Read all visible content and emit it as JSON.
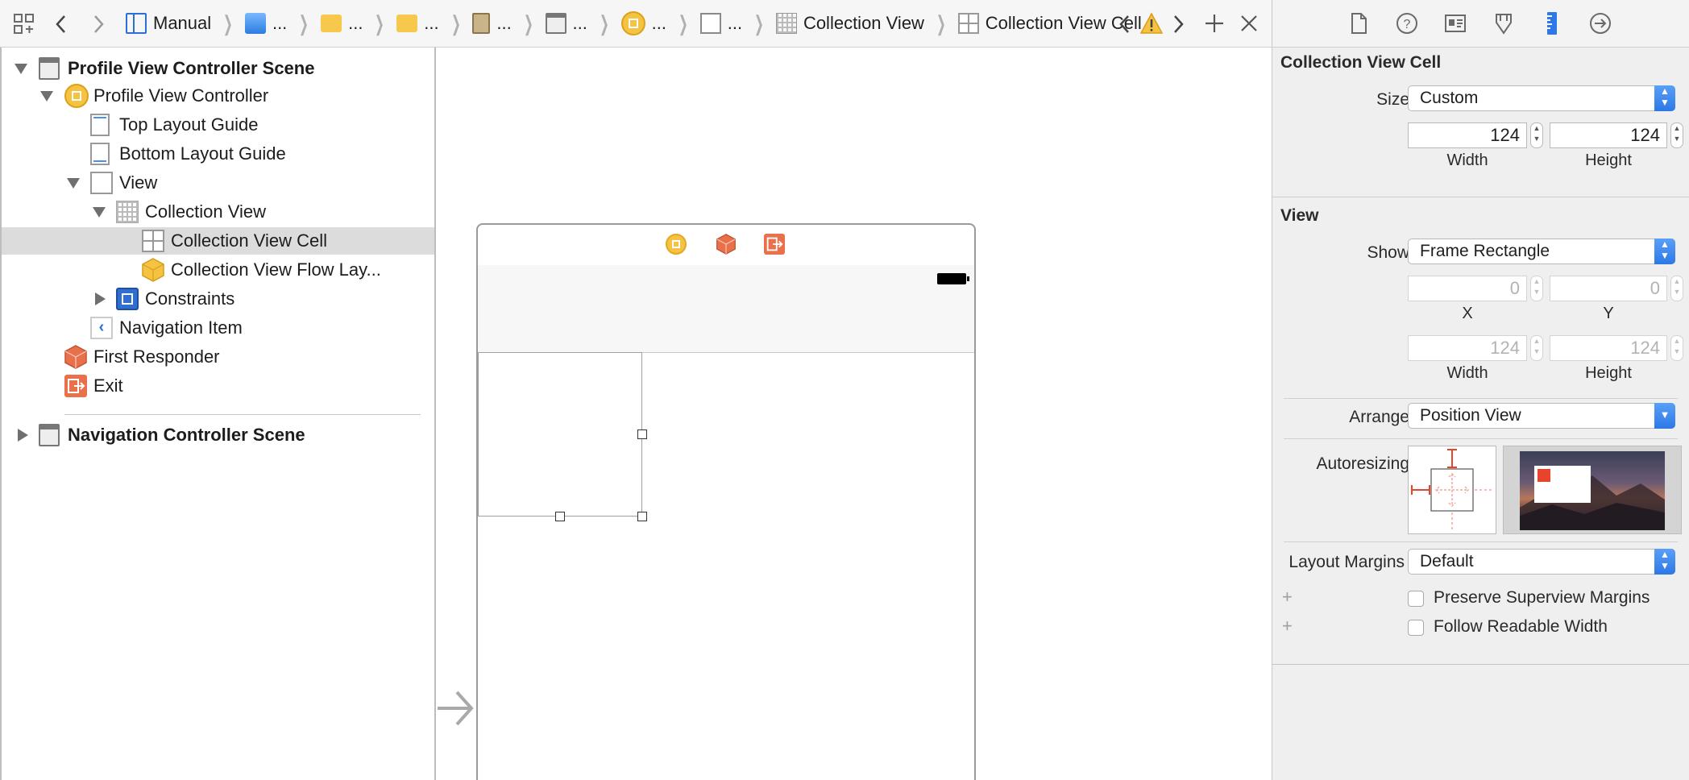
{
  "jumpbar": {
    "crumbs": [
      {
        "label": "Manual",
        "icon": "split-view-icon"
      },
      {
        "label": "...",
        "icon": "xcode-app-icon"
      },
      {
        "label": "...",
        "icon": "folder-icon"
      },
      {
        "label": "...",
        "icon": "folder-icon"
      },
      {
        "label": "...",
        "icon": "storyboard-file-icon"
      },
      {
        "label": "...",
        "icon": "scene-icon"
      },
      {
        "label": "...",
        "icon": "view-controller-icon"
      },
      {
        "label": "...",
        "icon": "view-icon"
      },
      {
        "label": "Collection View",
        "icon": "collection-view-icon"
      },
      {
        "label": "Collection View Cell",
        "icon": "collection-cell-icon"
      }
    ]
  },
  "outline": {
    "items": [
      {
        "label": "Profile View Controller Scene",
        "icon": "scene-icon"
      },
      {
        "label": "Profile View Controller",
        "icon": "view-controller-icon"
      },
      {
        "label": "Top Layout Guide",
        "icon": "layout-guide-icon"
      },
      {
        "label": "Bottom Layout Guide",
        "icon": "layout-guide-icon"
      },
      {
        "label": "View",
        "icon": "view-icon"
      },
      {
        "label": "Collection View",
        "icon": "collection-view-icon"
      },
      {
        "label": "Collection View Cell",
        "icon": "collection-cell-icon"
      },
      {
        "label": "Collection View Flow Lay...",
        "icon": "flow-layout-icon"
      },
      {
        "label": "Constraints",
        "icon": "constraints-icon"
      },
      {
        "label": "Navigation Item",
        "icon": "navigation-item-icon"
      },
      {
        "label": "First Responder",
        "icon": "first-responder-icon"
      },
      {
        "label": "Exit",
        "icon": "exit-icon"
      },
      {
        "label": "Navigation Controller Scene",
        "icon": "scene-icon"
      }
    ]
  },
  "inspector": {
    "tabs": [
      "file-inspector-icon",
      "help-icon",
      "identity-icon",
      "attributes-icon",
      "size-icon",
      "connections-icon"
    ],
    "cell_section": {
      "title": "Collection View Cell",
      "size_label": "Size",
      "size_value": "Custom",
      "width_value": "124",
      "height_value": "124",
      "width_label": "Width",
      "height_label": "Height"
    },
    "view_section": {
      "title": "View",
      "show_label": "Show",
      "show_value": "Frame Rectangle",
      "x_value": "0",
      "y_value": "0",
      "x_label": "X",
      "y_label": "Y",
      "width_value": "124",
      "height_value": "124",
      "width_label": "Width",
      "height_label": "Height",
      "arrange_label": "Arrange",
      "arrange_value": "Position View",
      "autoresizing_label": "Autoresizing",
      "layout_margins_label": "Layout Margins",
      "layout_margins_value": "Default",
      "preserve_label": "Preserve Superview Margins",
      "readable_label": "Follow Readable Width"
    }
  },
  "colors": {
    "accent": "#2d78e6",
    "selection": "#dcdcdc",
    "resizing_red": "#e8432b",
    "controller_yellow": "#f5c242",
    "responder_orange": "#e8704a"
  }
}
